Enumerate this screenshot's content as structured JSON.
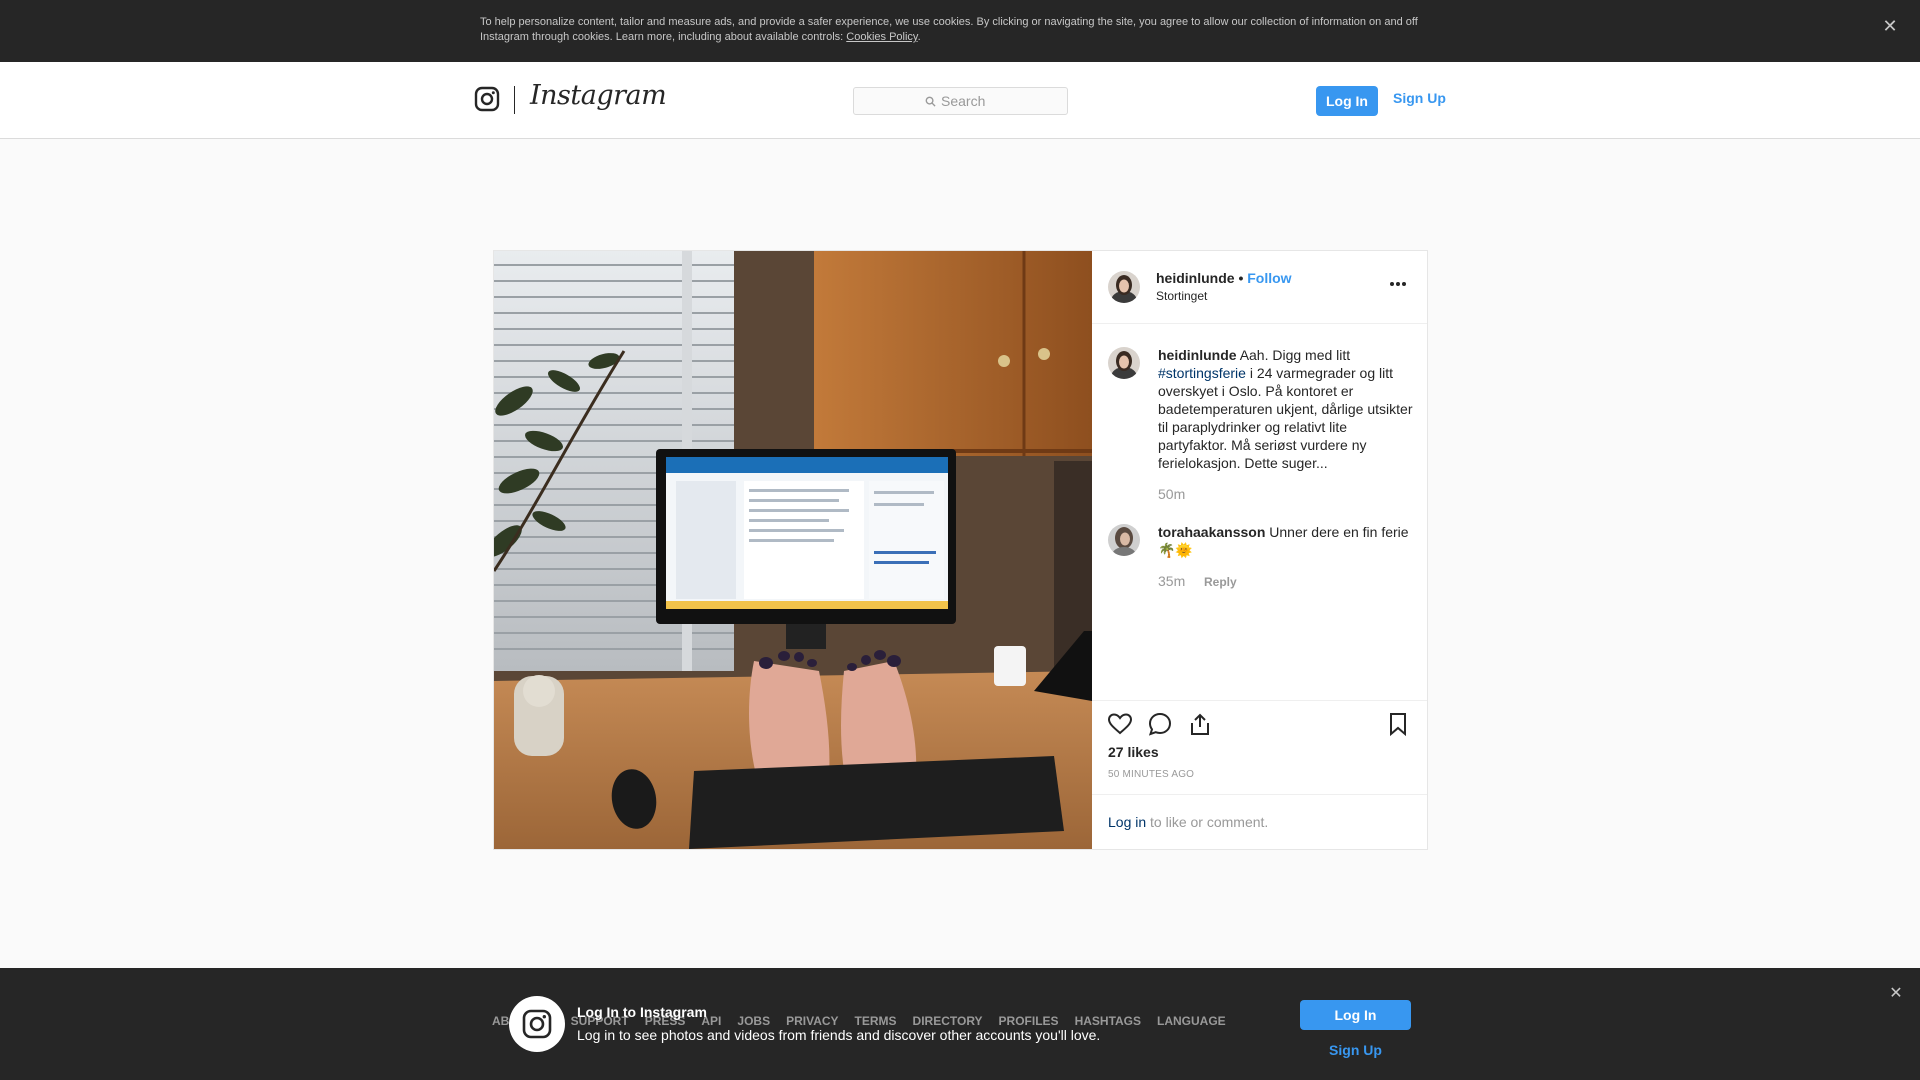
{
  "cookie_banner": {
    "text": "To help personalize content, tailor and measure ads, and provide a safer experience, we use cookies. By clicking or navigating the site, you agree to allow our collection of information on and off Instagram through cookies. Learn more, including about available controls: ",
    "link_label": "Cookies Policy",
    "trailing": ".",
    "close_glyph": "✕"
  },
  "header": {
    "brand": "Instagram",
    "search_placeholder": "Search",
    "login_label": "Log In",
    "signup_label": "Sign Up"
  },
  "post": {
    "author": "heidinlunde",
    "follow_separator": "•",
    "follow_label": "Follow",
    "location": "Stortinget",
    "caption": {
      "user": "heidinlunde",
      "text_before": "Aah. Digg med litt",
      "hashtag": "#stortingsferie",
      "text_after": "i 24 varmegrader og litt overskyet i Oslo. På kontoret er badetemperaturen ukjent, dårlige utsikter til paraplydrinker og relativt lite partyfaktor. Må seriøst vurdere ny ferielokasjon. Dette suger...",
      "time": "50m"
    },
    "comments": [
      {
        "user": "torahaakansson",
        "text": "Unner dere en fin ferie 🌴🌞",
        "time": "35m",
        "reply_label": "Reply"
      }
    ],
    "likes": "27 likes",
    "posted_ago": "50 MINUTES AGO",
    "login_prompt_link": "Log in",
    "login_prompt_rest": "to like or comment."
  },
  "footer": {
    "links": [
      "ABOUT US",
      "SUPPORT",
      "PRESS",
      "API",
      "JOBS",
      "PRIVACY",
      "TERMS",
      "DIRECTORY",
      "PROFILES",
      "HASHTAGS",
      "LANGUAGE"
    ]
  },
  "bottom_overlay": {
    "title": "Log In to Instagram",
    "text": "Log in to see photos and videos from friends and discover other accounts you'll love.",
    "login_label": "Log In",
    "signup_label": "Sign Up",
    "close_glyph": "✕"
  },
  "colors": {
    "accent": "#3897f0",
    "dark_link": "#003569",
    "banner_bg": "#262626",
    "border": "#dbdbdb"
  }
}
